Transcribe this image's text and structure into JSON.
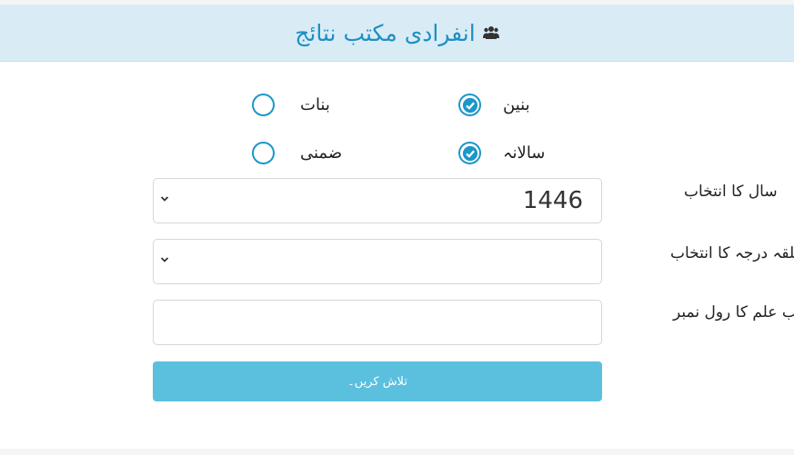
{
  "header": {
    "title": "انفرادی مکتب نتائج",
    "icon": "users-icon"
  },
  "radios": {
    "boys": {
      "label": "بنین",
      "checked": true
    },
    "girls": {
      "label": "بنات",
      "checked": false
    },
    "annual": {
      "label": "سالانہ",
      "checked": true
    },
    "supplementary": {
      "label": "ضمنی",
      "checked": false
    }
  },
  "form": {
    "year_label": "سال کا انتخاب",
    "year_value": "1446",
    "class_label": "متعلقہ درجہ کا انتخاب",
    "class_value": "",
    "roll_label": "طالب علم کا رول نمبر",
    "roll_value": "",
    "search_label": "تلاش کریں۔"
  },
  "colors": {
    "accent": "#1b97c9",
    "header_bg": "#d9ecf6",
    "button": "#5bc0de"
  }
}
